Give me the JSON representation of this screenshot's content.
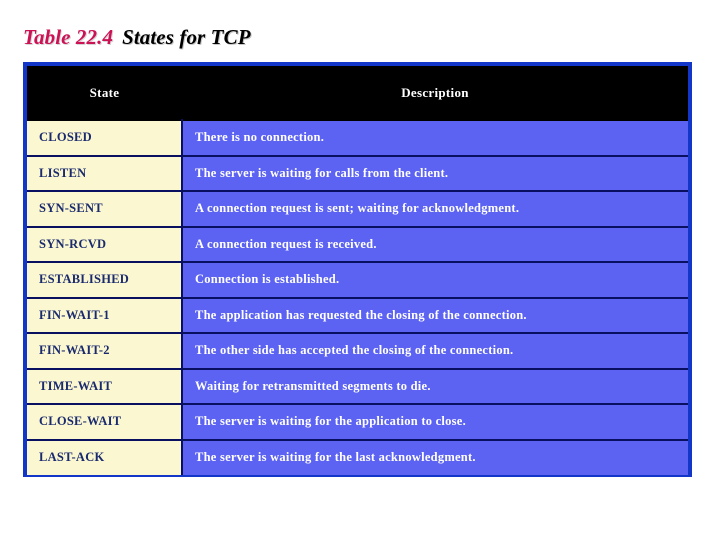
{
  "title": {
    "label": "Table 22.4",
    "text": "States for TCP"
  },
  "colors": {
    "title_label": "#cc1155",
    "title_text": "#000000",
    "table_border": "#1236c8",
    "header_bg": "#000000",
    "header_text": "#ffffff",
    "state_cell_bg": "#fbf7d0",
    "state_cell_text": "#1a2a6e",
    "desc_cell_bg": "#5c63f2",
    "desc_cell_text": "#ffffff",
    "grid_line": "#0a1060",
    "page_bg": "#ffffff"
  },
  "table": {
    "columns": [
      {
        "key": "state",
        "header": "State"
      },
      {
        "key": "description",
        "header": "Description"
      }
    ],
    "rows": [
      {
        "state": "CLOSED",
        "description": "There is no connection."
      },
      {
        "state": "LISTEN",
        "description": "The server is waiting for calls from the client."
      },
      {
        "state": "SYN-SENT",
        "description": "A connection request is sent; waiting for acknowledgment."
      },
      {
        "state": "SYN-RCVD",
        "description": "A connection request is received."
      },
      {
        "state": "ESTABLISHED",
        "description": "Connection is established."
      },
      {
        "state": "FIN-WAIT-1",
        "description": "The application has requested the closing of the connection."
      },
      {
        "state": "FIN-WAIT-2",
        "description": "The other side has accepted the closing of the connection."
      },
      {
        "state": "TIME-WAIT",
        "description": "Waiting for retransmitted segments to die."
      },
      {
        "state": "CLOSE-WAIT",
        "description": "The server is waiting for the application to close."
      },
      {
        "state": "LAST-ACK",
        "description": "The server is waiting for the last acknowledgment."
      }
    ]
  }
}
